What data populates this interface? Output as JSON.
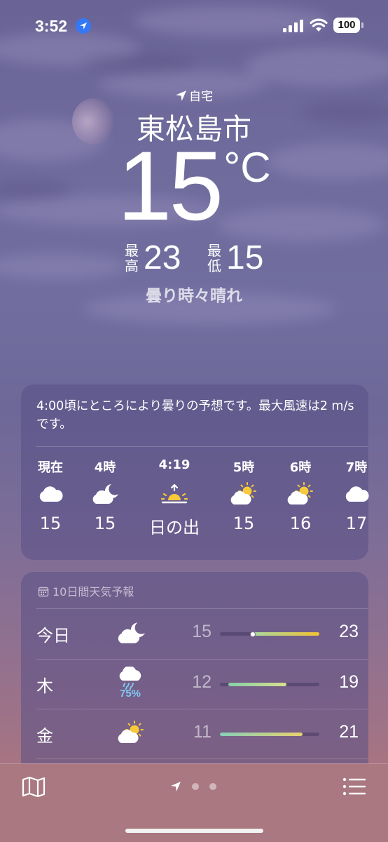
{
  "status_bar": {
    "time": "3:52",
    "battery": "100"
  },
  "location": {
    "label": "自宅",
    "city": "東松島市"
  },
  "current": {
    "temp": "15",
    "unit": "°C",
    "high_label": "最高",
    "high": "23",
    "low_label": "最低",
    "low": "15",
    "condition": "曇り時々晴れ"
  },
  "hourly": {
    "summary": "4:00頃にところにより曇りの予想です。最大風速は2 m/sです。",
    "items": [
      {
        "label": "現在",
        "icon": "cloud-icon",
        "value": "15"
      },
      {
        "label": "4時",
        "icon": "partly-cloudy-night-icon",
        "value": "15"
      },
      {
        "label": "4:19",
        "icon": "sunrise-icon",
        "value": "日の出"
      },
      {
        "label": "5時",
        "icon": "partly-sunny-icon",
        "value": "15"
      },
      {
        "label": "6時",
        "icon": "partly-sunny-icon",
        "value": "16"
      },
      {
        "label": "7時",
        "icon": "cloud-icon",
        "value": "17"
      }
    ]
  },
  "daily": {
    "title": "10日間天気予報",
    "range": [
      11,
      23
    ],
    "days": [
      {
        "name": "今日",
        "icon": "partly-cloudy-night-icon",
        "precip": "",
        "low": "15",
        "high": "23",
        "current": 15,
        "bar_colors": [
          "#a8d8a0",
          "#f1c232"
        ]
      },
      {
        "name": "木",
        "icon": "rain-cloud-icon",
        "precip": "75%",
        "low": "12",
        "high": "19",
        "bar_colors": [
          "#86cfa8",
          "#d8e08c"
        ]
      },
      {
        "name": "金",
        "icon": "partly-sunny-icon",
        "precip": "",
        "low": "11",
        "high": "21",
        "bar_colors": [
          "#86cfb8",
          "#e8d070"
        ]
      }
    ]
  },
  "bottom_bar": {
    "pages": 3,
    "active_page": 0
  },
  "colors": {
    "accent_blue": "#3478f6",
    "sun_yellow": "#f8c93a",
    "precip_blue": "#7fc9f5"
  }
}
